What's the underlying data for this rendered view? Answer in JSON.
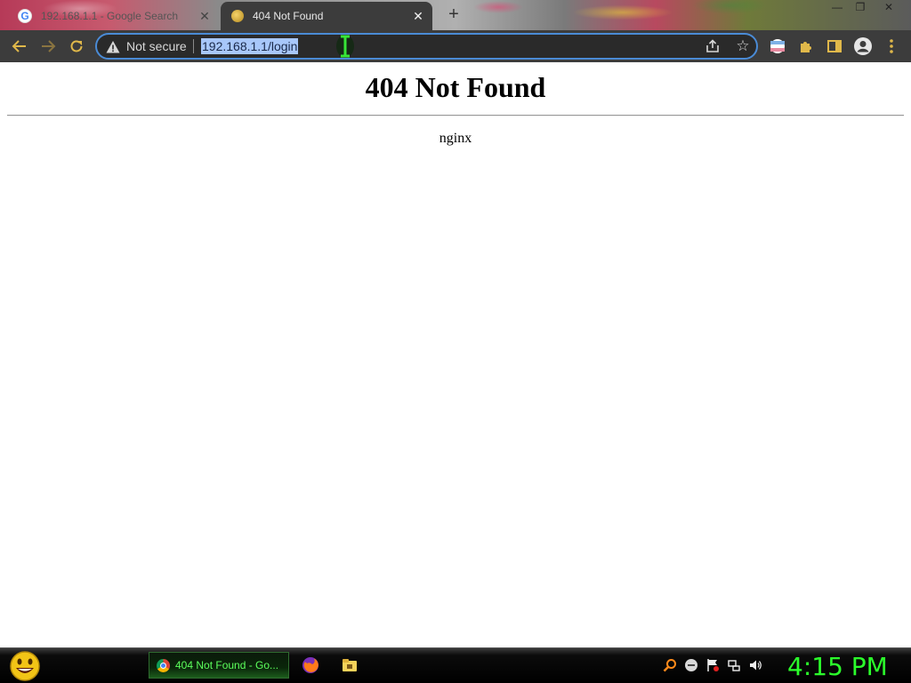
{
  "tabs": [
    {
      "title": "192.168.1.1 - Google Search",
      "close": "✕"
    },
    {
      "title": "404 Not Found",
      "close": "✕"
    }
  ],
  "new_tab_symbol": "+",
  "window_controls": {
    "minimize": "—",
    "maximize": "❐",
    "close": "✕"
  },
  "omnibox": {
    "security_label": "Not secure",
    "url": "192.168.1.1/login"
  },
  "icons": {
    "back": "back-arrow-icon",
    "forward": "forward-arrow-icon",
    "reload": "reload-icon",
    "warning": "warning-icon",
    "share": "share-icon",
    "bookmark": "star-icon",
    "profile_flag": "flag-icon",
    "extensions": "puzzle-icon",
    "side_panel": "side-panel-icon",
    "account": "account-icon",
    "menu": "kebab-menu-icon"
  },
  "page": {
    "heading": "404 Not Found",
    "server": "nginx"
  },
  "taskbar": {
    "active_window_label": "404 Not Found - Go...",
    "clock": "4:15 PM",
    "accent": "#2bff2b"
  }
}
